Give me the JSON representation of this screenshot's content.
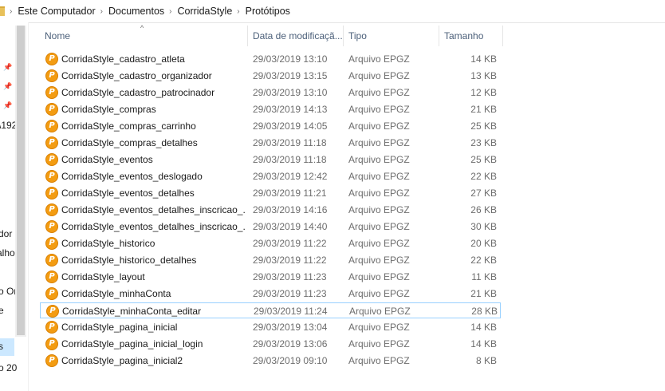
{
  "breadcrumb": {
    "items": [
      "Este Computador",
      "Documentos",
      "CorridaStyle",
      "Protótipos"
    ],
    "separator": "›"
  },
  "navpane": {
    "items": [
      "\\192",
      "dor",
      "alho",
      "o Or",
      "e",
      "s",
      "o 20"
    ],
    "pin_icon": "pin-icon"
  },
  "columns": {
    "name": "Nome",
    "date": "Data de modificaçã...",
    "type": "Tipo",
    "size": "Tamanho"
  },
  "sort_indicator": "^",
  "files": [
    {
      "name": "CorridaStyle_cadastro_atleta",
      "date": "29/03/2019 13:10",
      "type": "Arquivo EPGZ",
      "size": "14 KB"
    },
    {
      "name": "CorridaStyle_cadastro_organizador",
      "date": "29/03/2019 13:15",
      "type": "Arquivo EPGZ",
      "size": "13 KB"
    },
    {
      "name": "CorridaStyle_cadastro_patrocinador",
      "date": "29/03/2019 13:10",
      "type": "Arquivo EPGZ",
      "size": "12 KB"
    },
    {
      "name": "CorridaStyle_compras",
      "date": "29/03/2019 14:13",
      "type": "Arquivo EPGZ",
      "size": "21 KB"
    },
    {
      "name": "CorridaStyle_compras_carrinho",
      "date": "29/03/2019 14:05",
      "type": "Arquivo EPGZ",
      "size": "25 KB"
    },
    {
      "name": "CorridaStyle_compras_detalhes",
      "date": "29/03/2019 11:18",
      "type": "Arquivo EPGZ",
      "size": "23 KB"
    },
    {
      "name": "CorridaStyle_eventos",
      "date": "29/03/2019 11:18",
      "type": "Arquivo EPGZ",
      "size": "25 KB"
    },
    {
      "name": "CorridaStyle_eventos_deslogado",
      "date": "29/03/2019 12:42",
      "type": "Arquivo EPGZ",
      "size": "22 KB"
    },
    {
      "name": "CorridaStyle_eventos_detalhes",
      "date": "29/03/2019 11:21",
      "type": "Arquivo EPGZ",
      "size": "27 KB"
    },
    {
      "name": "CorridaStyle_eventos_detalhes_inscricao_...",
      "date": "29/03/2019 14:16",
      "type": "Arquivo EPGZ",
      "size": "26 KB"
    },
    {
      "name": "CorridaStyle_eventos_detalhes_inscricao_...",
      "date": "29/03/2019 14:40",
      "type": "Arquivo EPGZ",
      "size": "30 KB"
    },
    {
      "name": "CorridaStyle_historico",
      "date": "29/03/2019 11:22",
      "type": "Arquivo EPGZ",
      "size": "20 KB"
    },
    {
      "name": "CorridaStyle_historico_detalhes",
      "date": "29/03/2019 11:22",
      "type": "Arquivo EPGZ",
      "size": "22 KB"
    },
    {
      "name": "CorridaStyle_layout",
      "date": "29/03/2019 11:23",
      "type": "Arquivo EPGZ",
      "size": "11 KB"
    },
    {
      "name": "CorridaStyle_minhaConta",
      "date": "29/03/2019 11:23",
      "type": "Arquivo EPGZ",
      "size": "21 KB"
    },
    {
      "name": "CorridaStyle_minhaConta_editar",
      "date": "29/03/2019 11:24",
      "type": "Arquivo EPGZ",
      "size": "28 KB",
      "focused": true
    },
    {
      "name": "CorridaStyle_pagina_inicial",
      "date": "29/03/2019 13:04",
      "type": "Arquivo EPGZ",
      "size": "14 KB"
    },
    {
      "name": "CorridaStyle_pagina_inicial_login",
      "date": "29/03/2019 13:06",
      "type": "Arquivo EPGZ",
      "size": "14 KB"
    },
    {
      "name": "CorridaStyle_pagina_inicial2",
      "date": "29/03/2019 09:10",
      "type": "Arquivo EPGZ",
      "size": "8 KB"
    }
  ],
  "file_icon": {
    "name": "epgz-file-icon",
    "glyph": "P",
    "color": "#f39c12"
  },
  "colors": {
    "focus_border": "#99d1ff",
    "selection": "#cce8ff",
    "header_text": "#4c607a"
  }
}
